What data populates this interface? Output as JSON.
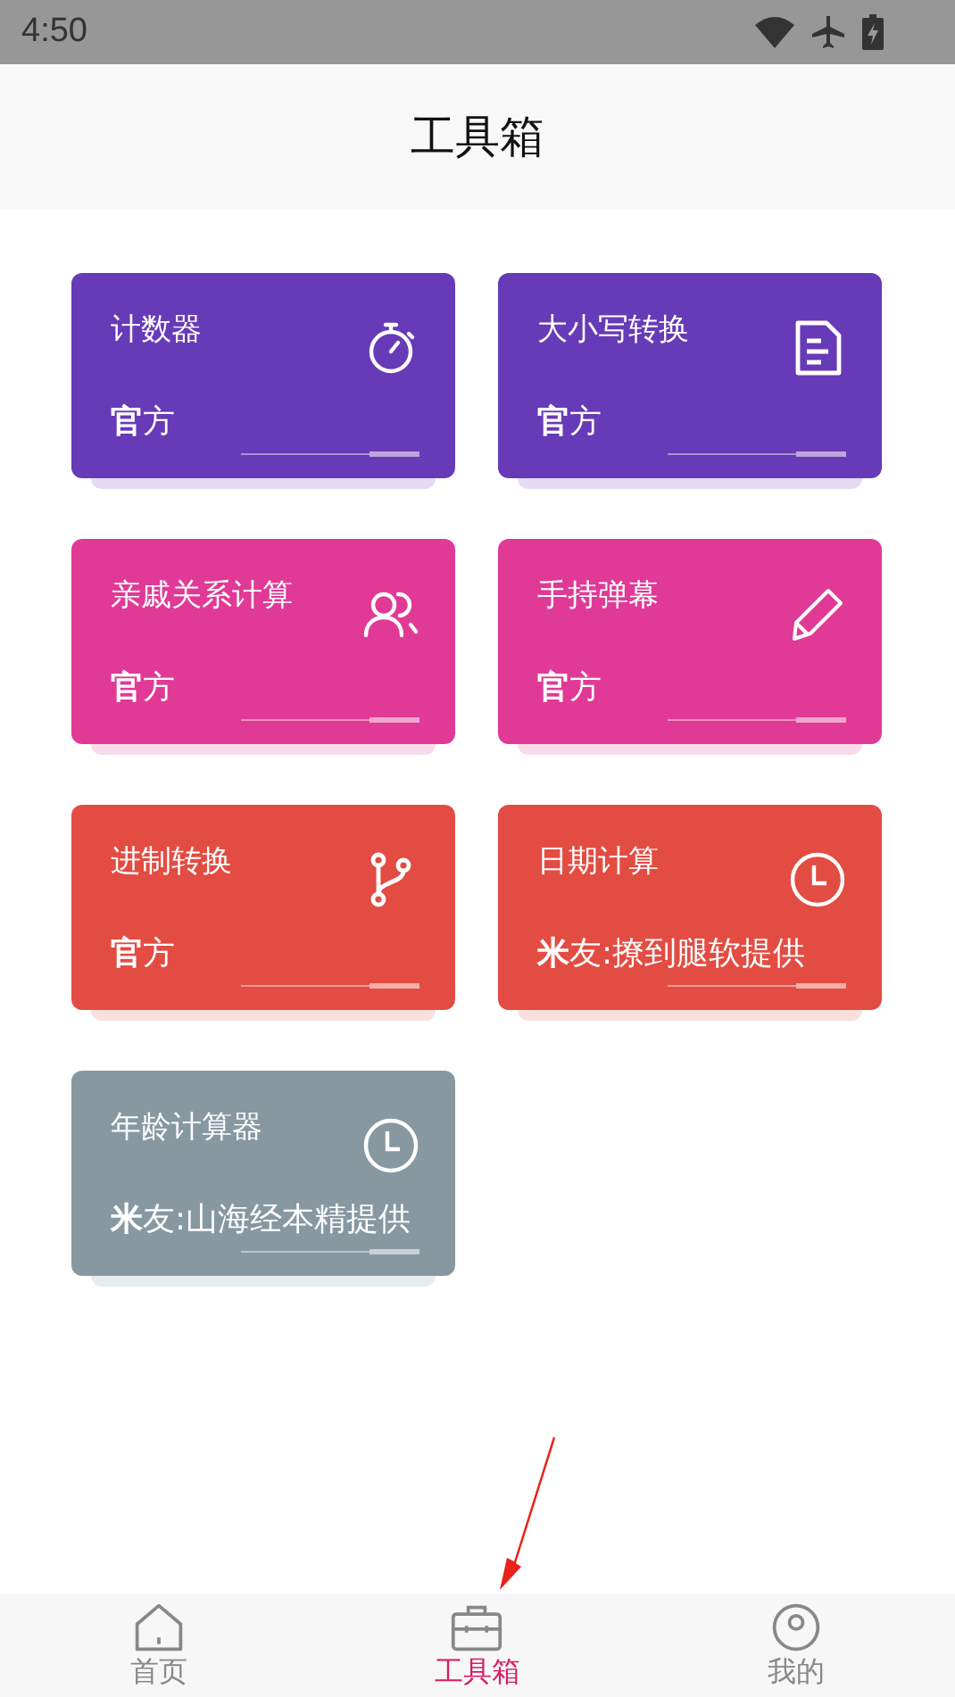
{
  "status_bar": {
    "time": "4:50"
  },
  "header": {
    "title": "工具箱"
  },
  "tools": [
    {
      "title": "计数器",
      "provider": "**官**方",
      "color": "#673ab7"
    },
    {
      "title": "大小写转换",
      "provider": "**官**方",
      "color": "#673ab7"
    },
    {
      "title": "亲戚关系计算",
      "provider": "**官**方",
      "color": "#e03a96"
    },
    {
      "title": "手持弹幕",
      "provider": "**官**方",
      "color": "#e03a96"
    },
    {
      "title": "进制转换",
      "provider": "**官**方",
      "color": "#e34c42"
    },
    {
      "title": "日期计算",
      "provider": "**米**友:撩到腿软提供",
      "color": "#e34c42"
    },
    {
      "title": "年龄计算器",
      "provider": "**米**友:山海经本精提供",
      "color": "#8798a1"
    }
  ],
  "bottom_nav": [
    {
      "label": "首页",
      "selected": false
    },
    {
      "label": "工具箱",
      "selected": true
    },
    {
      "label": "我的",
      "selected": false
    }
  ]
}
